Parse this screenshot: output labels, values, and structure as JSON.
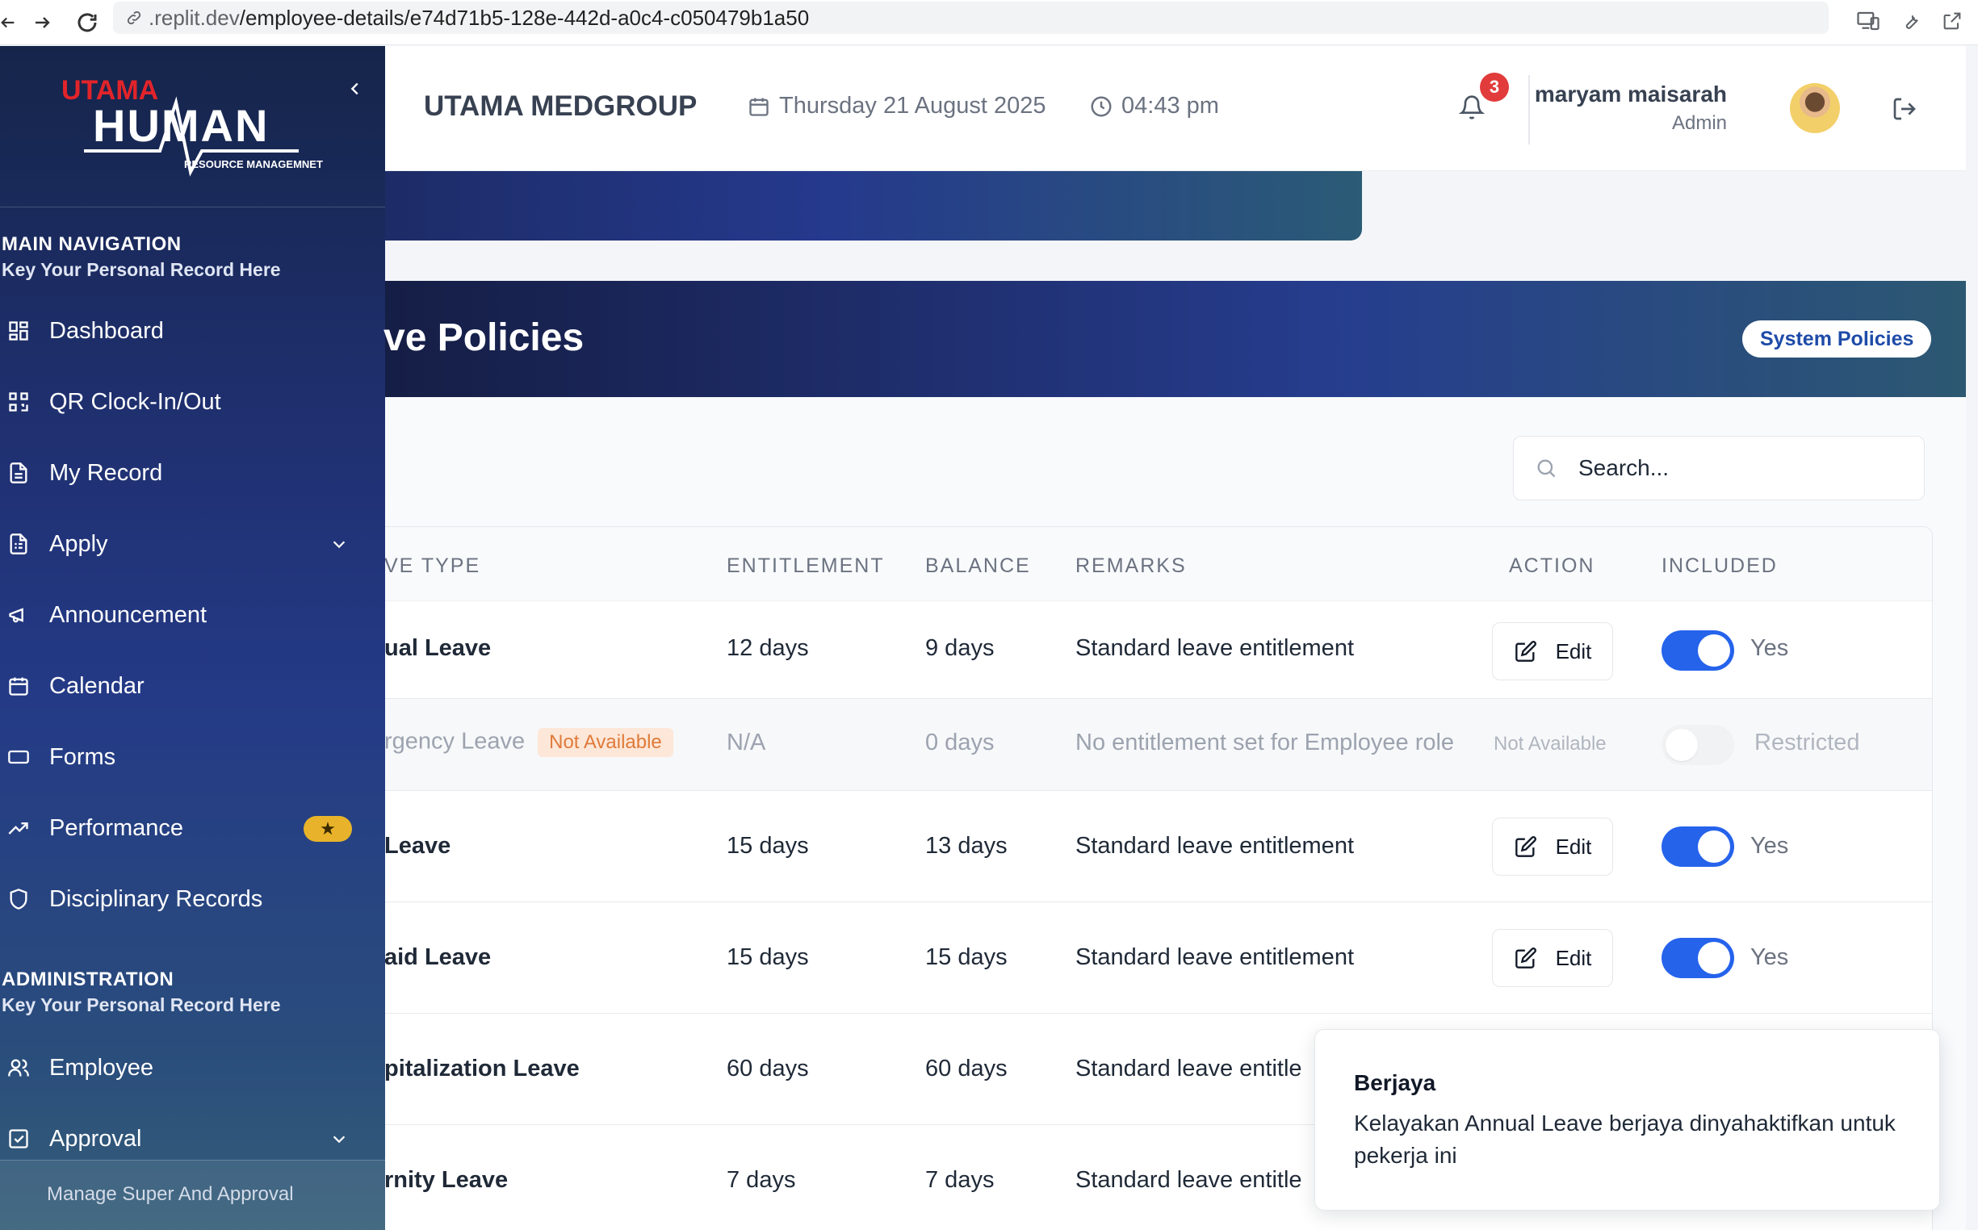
{
  "browser": {
    "url_prefix": ".replit.dev",
    "url_path": "/employee-details/e74d71b5-128e-442d-a0c4-c050479b1a50"
  },
  "sidebar": {
    "logo": {
      "line1": "UTAMA",
      "line2": "HUMAN",
      "line3": "RESOURCE MANAGEMNET"
    },
    "main_nav": {
      "title": "MAIN NAVIGATION",
      "subtitle": "Key Your Personal Record Here",
      "items": [
        {
          "label": "Dashboard",
          "icon": "grid-icon"
        },
        {
          "label": "QR Clock-In/Out",
          "icon": "qr-icon"
        },
        {
          "label": "My Record",
          "icon": "document-icon"
        },
        {
          "label": "Apply",
          "icon": "form-icon",
          "has_chevron": true
        },
        {
          "label": "Announcement",
          "icon": "megaphone-icon"
        },
        {
          "label": "Calendar",
          "icon": "calendar-icon"
        },
        {
          "label": "Forms",
          "icon": "card-icon"
        },
        {
          "label": "Performance",
          "icon": "trend-icon",
          "badge": "★"
        },
        {
          "label": "Disciplinary Records",
          "icon": "shield-icon"
        }
      ]
    },
    "admin": {
      "title": "ADMINISTRATION",
      "subtitle": "Key Your Personal Record Here",
      "items": [
        {
          "label": "Employee",
          "icon": "users-icon"
        },
        {
          "label": "Approval",
          "icon": "check-square-icon",
          "has_chevron": true
        }
      ]
    },
    "footer": "Manage Super And Approval"
  },
  "header": {
    "company": "UTAMA MEDGROUP",
    "date": "Thursday 21 August 2025",
    "time": "04:43 pm",
    "notifications": "3",
    "user_name": "maryam maisarah",
    "user_role": "Admin"
  },
  "policies": {
    "title": "ve Policies",
    "system_button": "System Policies",
    "search_placeholder": "Search...",
    "columns": {
      "leave_type": "VE TYPE",
      "entitlement": "ENTITLEMENT",
      "balance": "BALANCE",
      "remarks": "REMARKS",
      "action": "ACTION",
      "included": "INCLUDED"
    },
    "rows": [
      {
        "leave_type": "ual Leave",
        "entitlement": "12 days",
        "balance": "9 days",
        "remarks": "Standard leave entitlement",
        "action": "Edit",
        "included": "Yes",
        "enabled": true
      },
      {
        "leave_type": "rgency Leave",
        "badge": "Not Available",
        "entitlement": "N/A",
        "balance": "0 days",
        "remarks": "No entitlement set for Employee role",
        "action": "Not Available",
        "included": "Restricted",
        "enabled": false
      },
      {
        "leave_type": " Leave",
        "entitlement": "15 days",
        "balance": "13 days",
        "remarks": "Standard leave entitlement",
        "action": "Edit",
        "included": "Yes",
        "enabled": true
      },
      {
        "leave_type": "aid Leave",
        "entitlement": "15 days",
        "balance": "15 days",
        "remarks": "Standard leave entitlement",
        "action": "Edit",
        "included": "Yes",
        "enabled": true
      },
      {
        "leave_type": "pitalization Leave",
        "entitlement": "60 days",
        "balance": "60 days",
        "remarks": "Standard leave entitle",
        "action": "",
        "included": "",
        "enabled": true
      },
      {
        "leave_type": "rnity Leave",
        "entitlement": "7 days",
        "balance": "7 days",
        "remarks": "Standard leave entitle",
        "action": "",
        "included": "",
        "enabled": true
      }
    ]
  },
  "toast": {
    "title": "Berjaya",
    "message": "Kelayakan Annual Leave berjaya dinyahaktifkan untuk pekerja ini"
  },
  "colors": {
    "accent": "#2563eb",
    "sidebar_top": "#15254a",
    "badge_red": "#e23b3b",
    "star_badge": "#e8b32a",
    "na_badge_bg": "#fde7d8",
    "na_badge_text": "#e07a3a"
  }
}
